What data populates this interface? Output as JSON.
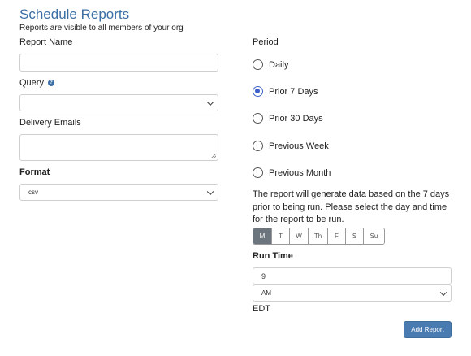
{
  "header": {
    "title": "Schedule Reports",
    "subtitle": "Reports are visible to all members of your org"
  },
  "form": {
    "report_name": {
      "label": "Report Name",
      "value": ""
    },
    "query": {
      "label": "Query",
      "value": ""
    },
    "delivery_emails": {
      "label": "Delivery Emails",
      "value": ""
    },
    "format": {
      "label": "Format",
      "value": "csv"
    }
  },
  "period": {
    "label": "Period",
    "options": [
      {
        "label": "Daily",
        "checked": false
      },
      {
        "label": "Prior 7 Days",
        "checked": true
      },
      {
        "label": "Prior 30 Days",
        "checked": false
      },
      {
        "label": "Previous Week",
        "checked": false
      },
      {
        "label": "Previous Month",
        "checked": false
      }
    ],
    "description": "The report will generate data based on the 7 days prior to being run. Please select the day and time for the report to be run."
  },
  "days": {
    "items": [
      {
        "label": "M",
        "active": true
      },
      {
        "label": "T",
        "active": false
      },
      {
        "label": "W",
        "active": false
      },
      {
        "label": "Th",
        "active": false
      },
      {
        "label": "F",
        "active": false
      },
      {
        "label": "S",
        "active": false
      },
      {
        "label": "Su",
        "active": false
      }
    ]
  },
  "run_time": {
    "label": "Run Time",
    "hour": "9",
    "ampm": "AM",
    "timezone": "EDT"
  },
  "actions": {
    "add_report": "Add Report"
  },
  "colors": {
    "title": "#3a6ea5",
    "radio_checked": "#3a5fc6",
    "day_active": "#6c757d",
    "button": "#4a7bb0"
  }
}
